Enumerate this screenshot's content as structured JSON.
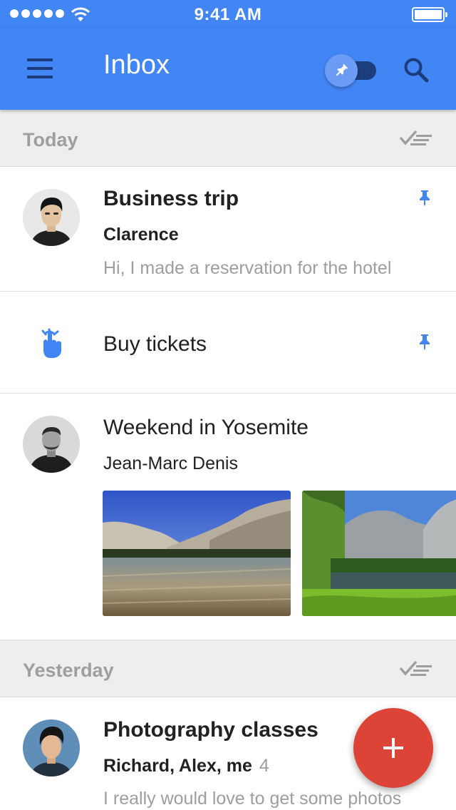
{
  "status_bar": {
    "time": "9:41 AM"
  },
  "app_bar": {
    "title": "Inbox"
  },
  "sections": {
    "today": {
      "label": "Today"
    },
    "yesterday": {
      "label": "Yesterday"
    }
  },
  "items": [
    {
      "subject": "Business trip",
      "sender": "Clarence",
      "snippet": "Hi, I made a reservation for the hotel",
      "pinned": true,
      "icon": "avatar"
    },
    {
      "subject": "Buy tickets",
      "pinned": true,
      "icon": "reminder-finger-icon"
    },
    {
      "subject": "Weekend in Yosemite",
      "sender": "Jean-Marc Denis",
      "attachments": [
        "lake-photo",
        "meadow-photo"
      ],
      "icon": "avatar"
    },
    {
      "subject": "Photography classes",
      "sender": "Richard, Alex, me",
      "count": "4",
      "snippet": "I really would love to get some photos",
      "icon": "avatar"
    }
  ],
  "colors": {
    "primary": "#4285f4",
    "primary_dark": "#1c3e7c",
    "fab": "#db4437",
    "pin": "#4285f4"
  },
  "fab": {
    "icon": "plus-icon"
  }
}
